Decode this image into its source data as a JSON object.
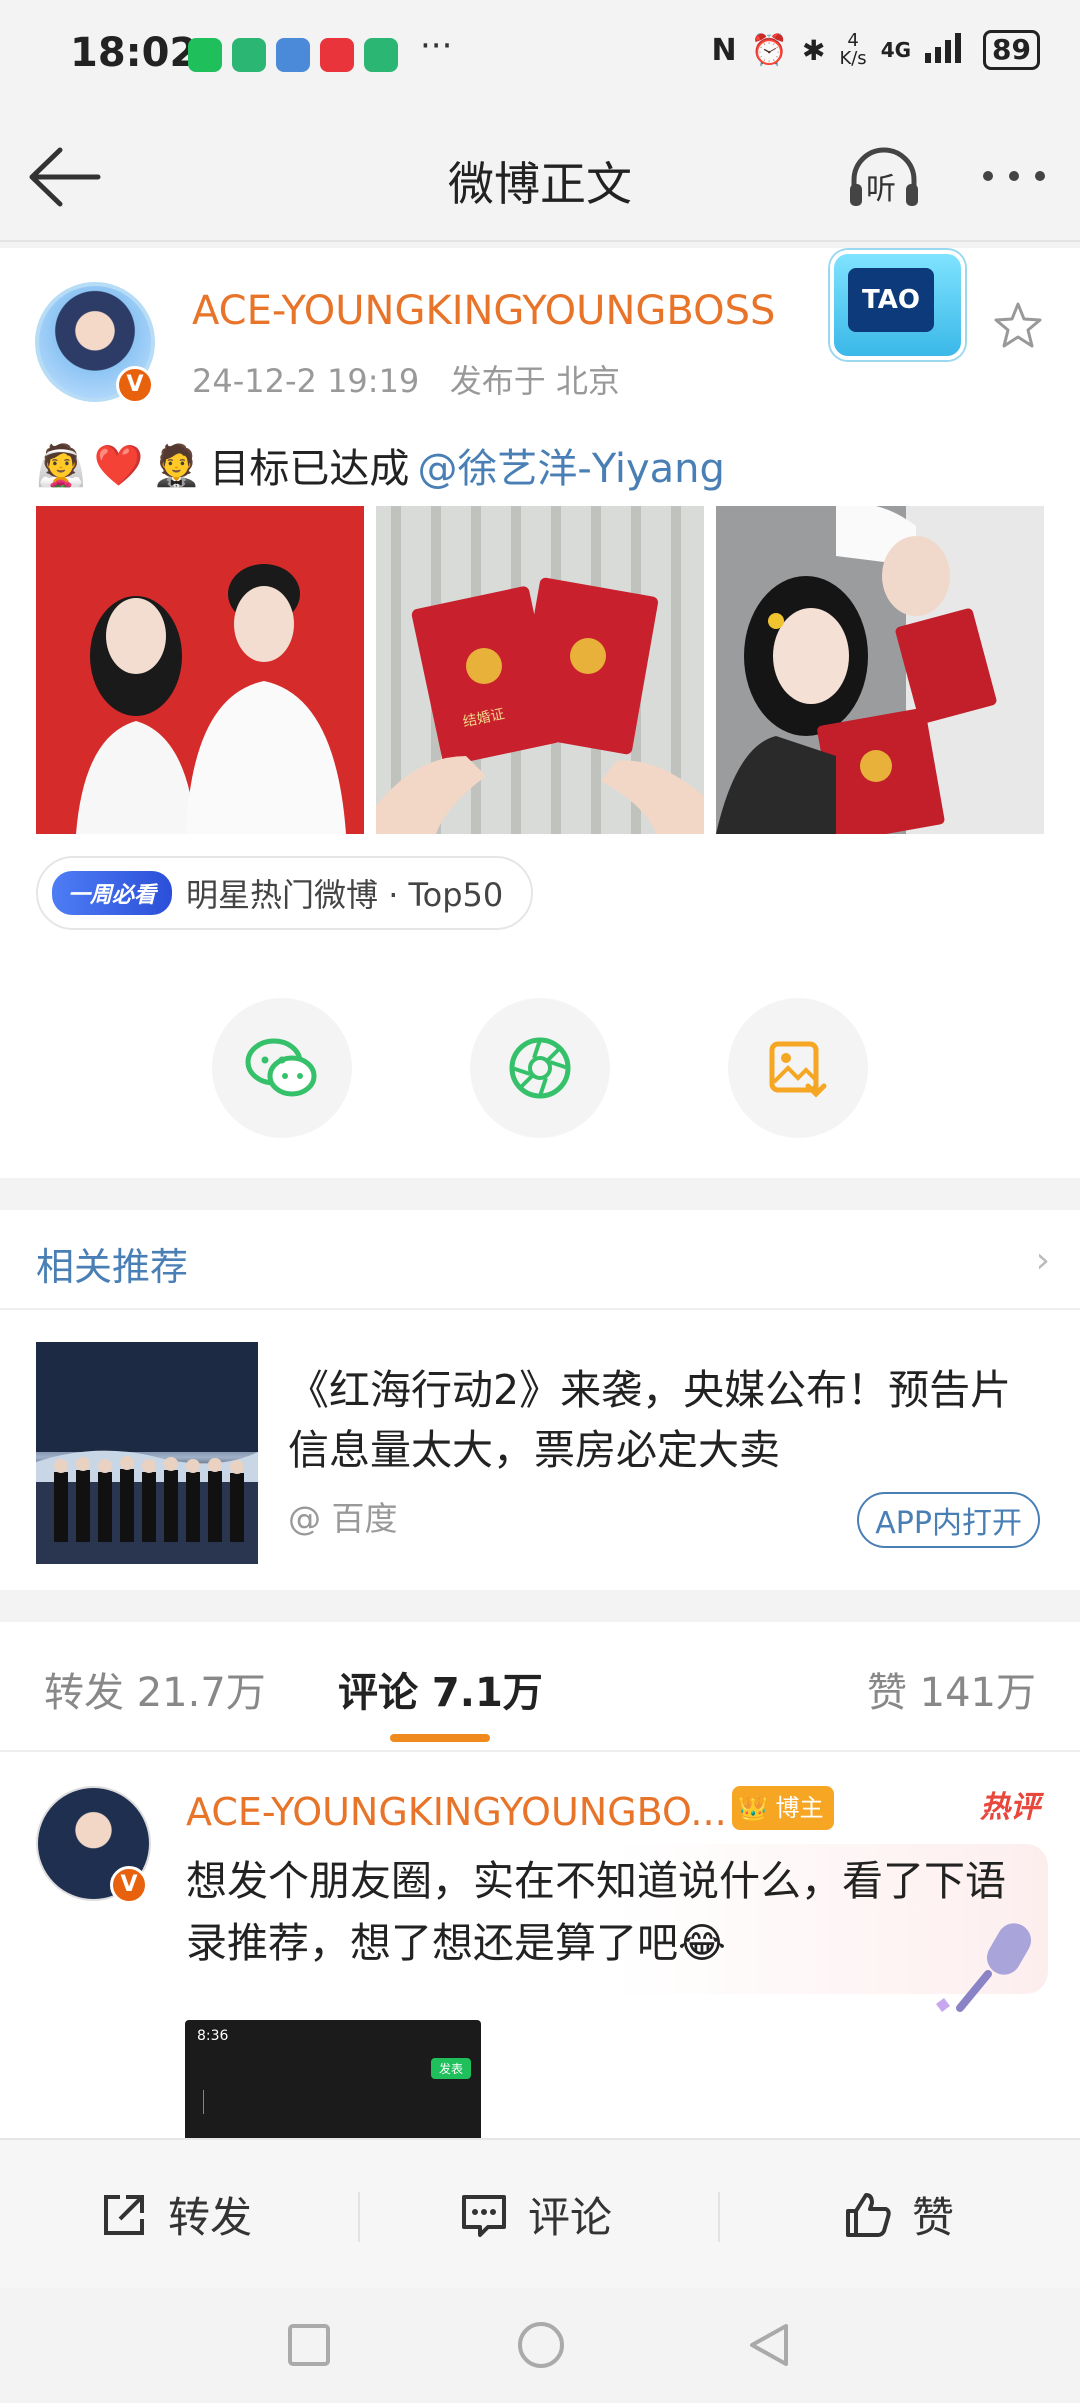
{
  "status_bar": {
    "time": "18:02",
    "more": "···",
    "net_speed": "4\nK/s",
    "network": "4G",
    "battery": "89"
  },
  "header": {
    "title": "微博正文",
    "listen_label": "听"
  },
  "post": {
    "username": "ACE-YOUNGKINGYOUNGBOSS",
    "badge_text": "TAO",
    "time": "24-12-2 19:19",
    "location": "发布于 北京",
    "text": "目标已达成",
    "mention": "@徐艺洋-Yiyang",
    "emoji": [
      "👰",
      "❤️",
      "🤵"
    ],
    "photos": [
      {
        "desc": "wedding-photo"
      },
      {
        "desc": "marriage-certificates"
      },
      {
        "desc": "couple-selfie"
      }
    ],
    "certificate_text": "结婚证",
    "tag_pill": "一周必看",
    "tag_text": "明星热门微博 · Top50",
    "share_icons": [
      "wechat-icon",
      "moments-icon",
      "save-image-icon"
    ]
  },
  "related": {
    "heading": "相关推荐",
    "title": "《红海行动2》来袭，央媒公布！预告片信息量太大，票房必定大卖",
    "source": "@ 百度",
    "open_app": "APP内打开"
  },
  "tabs": {
    "repost": "转发 21.7万",
    "comments": "评论 7.1万",
    "likes": "赞 141万"
  },
  "comment": {
    "username": "ACE-YOUNGKINGYOUNGBO...",
    "role": "博主",
    "hot": "热评",
    "text": "想发个朋友圈，实在不知道说什么，看了下语录推荐，想了想还是算了吧😂",
    "screenshot_time": "8:36",
    "screenshot_button": "发表"
  },
  "actions": {
    "repost": "转发",
    "comment": "评论",
    "like": "赞"
  },
  "colors": {
    "accent_orange": "#e8742a",
    "link_blue": "#4a7fb5",
    "tab_indicator": "#f08a1c"
  }
}
